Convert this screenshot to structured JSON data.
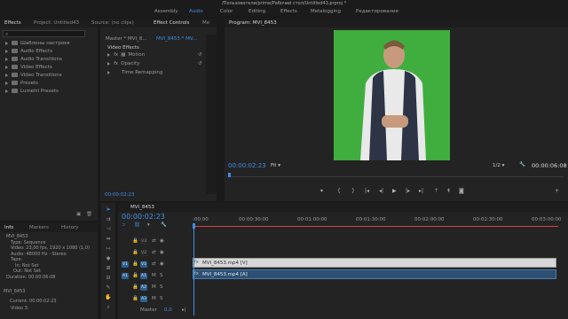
{
  "titlebar": {
    "path": "/Пользователи/prime/Рабочий стол/Untitled43.prproj *"
  },
  "workspaces": [
    "Assembly",
    "Audio",
    "Color",
    "Editing",
    "Effects",
    "Metalogging",
    "Редактирование"
  ],
  "active_workspace": "Audio",
  "effects_panel": {
    "tabs": [
      "Effects",
      "Project: Untitled43"
    ],
    "search_placeholder": "",
    "items": [
      "Шаблоны настроек",
      "Audio Effects",
      "Audio Transitions",
      "Video Effects",
      "Video Transitions",
      "Presets",
      "Lumetri Presets"
    ]
  },
  "effect_controls": {
    "source_tab": "Source: (no clips)",
    "tab": "Effect Controls",
    "extra_tab": "Me",
    "master_label": "Master * MVI_8...",
    "clip_label": "MVI_8453 * MV...",
    "section": "Video Effects",
    "effects": [
      "Motion",
      "Opacity",
      "Time Remapping"
    ],
    "timecode": "00:00:02:23"
  },
  "program_monitor": {
    "title": "Program: MVI_8453",
    "timecode": "00:00:02:23",
    "fit": "Fit",
    "resolution": "1/2",
    "duration": "00:00:06:08"
  },
  "info_panel": {
    "tabs": [
      "Info",
      "Markers",
      "History"
    ],
    "clip_name": "MVI_8453",
    "type": "Type: Sequence",
    "video": "Video: 23,00 fps, 1920 x 1080 (1,0)",
    "audio": "Audio: 48000 Hz - Stereo",
    "tape": "Tape:",
    "in_point": "In: Not Set",
    "out_point": "Out: Not Set",
    "duration": "Duration: 00:00:06:08",
    "sequence_name": "MVI_8453",
    "current": "Current: 00:00:02:23",
    "video_track": "Video 3:"
  },
  "timeline": {
    "tab": "MVI_8453",
    "timecode": "00:00:02:23",
    "ruler": [
      ":00:00",
      "00:00:30:00",
      "00:01:00:00",
      "00:01:30:00",
      "00:02:00:00",
      "00:02:30:00",
      "00:03:00:00"
    ],
    "video_tracks": [
      "V3",
      "V2",
      "V1"
    ],
    "audio_tracks": [
      "A1",
      "A2",
      "A3"
    ],
    "master_label": "Master",
    "master_value": "0,0",
    "video_clip": "MVI_8453.mp4 [V]",
    "audio_clip": "MVI_8453.mp4 [A]",
    "playhead_fraction": 0.003
  },
  "colors": {
    "accent": "#3d8ee6",
    "panel": "#232323",
    "green_screen": "#3fae3f",
    "playhead": "#e04040"
  }
}
